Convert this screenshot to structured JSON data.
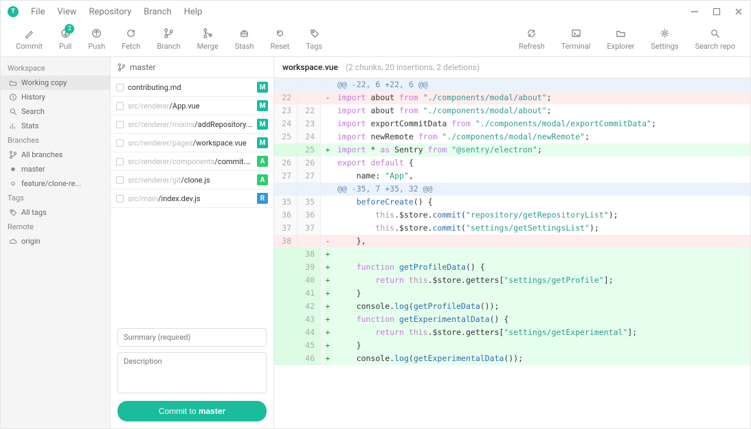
{
  "menubar": {
    "logo_text": "T",
    "items": [
      "File",
      "View",
      "Repository",
      "Branch",
      "Help"
    ]
  },
  "toolbar": {
    "left": [
      {
        "id": "commit",
        "label": "Commit",
        "icon": "pencil"
      },
      {
        "id": "pull",
        "label": "Pull",
        "icon": "arrow-down",
        "badge": "2"
      },
      {
        "id": "push",
        "label": "Push",
        "icon": "arrow-up"
      },
      {
        "id": "fetch",
        "label": "Fetch",
        "icon": "refresh"
      },
      {
        "id": "branch",
        "label": "Branch",
        "icon": "branch"
      },
      {
        "id": "merge",
        "label": "Merge",
        "icon": "merge"
      },
      {
        "id": "stash",
        "label": "Stash",
        "icon": "stash"
      },
      {
        "id": "reset",
        "label": "Reset",
        "icon": "reset"
      },
      {
        "id": "tags",
        "label": "Tags",
        "icon": "tag"
      }
    ],
    "right": [
      {
        "id": "refresh",
        "label": "Refresh",
        "icon": "refresh2"
      },
      {
        "id": "terminal",
        "label": "Terminal",
        "icon": "terminal"
      },
      {
        "id": "explorer",
        "label": "Explorer",
        "icon": "folder"
      },
      {
        "id": "settings",
        "label": "Settings",
        "icon": "gear"
      },
      {
        "id": "searchrepo",
        "label": "Search repo",
        "icon": "search"
      }
    ]
  },
  "sidebar": {
    "sections": [
      {
        "title": "Workspace",
        "items": [
          {
            "id": "working-copy",
            "label": "Working copy",
            "icon": "folder",
            "selected": true
          },
          {
            "id": "history",
            "label": "History",
            "icon": "clock"
          },
          {
            "id": "search",
            "label": "Search",
            "icon": "search"
          },
          {
            "id": "stats",
            "label": "Stats",
            "icon": "stats"
          }
        ]
      },
      {
        "title": "Branches",
        "items": [
          {
            "id": "all-branches",
            "label": "All branches",
            "icon": "branch"
          },
          {
            "id": "master",
            "label": "master",
            "icon": "dot"
          },
          {
            "id": "feature",
            "label": "feature/clone-re...",
            "icon": "circle"
          }
        ]
      },
      {
        "title": "Tags",
        "items": [
          {
            "id": "all-tags",
            "label": "All tags",
            "icon": "tag"
          }
        ]
      },
      {
        "title": "Remote",
        "items": [
          {
            "id": "origin",
            "label": "origin",
            "icon": "cloud"
          }
        ]
      }
    ]
  },
  "branchbar": {
    "icon": "branch",
    "name": "master"
  },
  "files": [
    {
      "prefix": "",
      "name": "contributing.md",
      "status": "M"
    },
    {
      "prefix": "src/renderer",
      "name": "/App.vue",
      "status": "M"
    },
    {
      "prefix": "src/renderer/mixins",
      "name": "/addRepository.js",
      "status": "M"
    },
    {
      "prefix": "src/renderer/pages",
      "name": "/workspace.vue",
      "status": "M"
    },
    {
      "prefix": "src/renderer/components",
      "name": "/commit.vue",
      "status": "A"
    },
    {
      "prefix": "src/renderer/git",
      "name": "/clone.js",
      "status": "A"
    },
    {
      "prefix": "src/main",
      "name": "/index.dev.js",
      "status": "R"
    }
  ],
  "commitform": {
    "summary_placeholder": "Summary (required)",
    "description_placeholder": "Description",
    "button_prefix": "Commit to ",
    "button_branch": "master"
  },
  "diff": {
    "filename": "workspace.vue",
    "stats": "(2 chunks, 20 insertions, 2 deletions)",
    "lines": [
      {
        "type": "hunk",
        "old": "",
        "new": "",
        "mark": "",
        "text": "@@ -22, 6 +22, 6 @@"
      },
      {
        "type": "del",
        "old": "22",
        "new": "",
        "mark": "-",
        "tokens": [
          [
            "kw",
            "import"
          ],
          [
            "id",
            " about "
          ],
          [
            "kw",
            "from"
          ],
          [
            "str",
            " \"./components/modal/about\""
          ],
          [
            "id",
            ";"
          ]
        ]
      },
      {
        "type": "ctx",
        "old": "23",
        "new": "22",
        "mark": "",
        "tokens": [
          [
            "kw",
            "import"
          ],
          [
            "id",
            " about "
          ],
          [
            "kw",
            "from"
          ],
          [
            "str",
            " \"./components/modal/about\""
          ],
          [
            "id",
            ";"
          ]
        ]
      },
      {
        "type": "ctx",
        "old": "24",
        "new": "23",
        "mark": "",
        "tokens": [
          [
            "kw",
            "import"
          ],
          [
            "id",
            " exportCommitData "
          ],
          [
            "kw",
            "from"
          ],
          [
            "str",
            " \"./components/modal/exportCommitData\""
          ],
          [
            "id",
            ";"
          ]
        ]
      },
      {
        "type": "ctx",
        "old": "25",
        "new": "24",
        "mark": "",
        "tokens": [
          [
            "kw",
            "import"
          ],
          [
            "id",
            " newRemote "
          ],
          [
            "kw",
            "from"
          ],
          [
            "str",
            " \"./components/modal/newRemote\""
          ],
          [
            "id",
            ";"
          ]
        ]
      },
      {
        "type": "add",
        "old": "",
        "new": "25",
        "mark": "+",
        "tokens": [
          [
            "kw",
            "import"
          ],
          [
            "id",
            " * "
          ],
          [
            "kw",
            "as"
          ],
          [
            "id",
            " Sentry "
          ],
          [
            "kw",
            "from"
          ],
          [
            "str",
            " \"@sentry/electron\""
          ],
          [
            "id",
            ";"
          ]
        ]
      },
      {
        "type": "ctx",
        "old": "26",
        "new": "26",
        "mark": "",
        "tokens": [
          [
            "kw",
            "export"
          ],
          [
            "id",
            " "
          ],
          [
            "kw",
            "default"
          ],
          [
            "id",
            " {"
          ]
        ]
      },
      {
        "type": "ctx",
        "old": "27",
        "new": "27",
        "mark": "",
        "tokens": [
          [
            "id",
            "    name: "
          ],
          [
            "str",
            "\"App\""
          ],
          [
            "id",
            ","
          ]
        ]
      },
      {
        "type": "hunk",
        "old": "",
        "new": "",
        "mark": "",
        "text": "@@ -35, 7 +35, 32 @@"
      },
      {
        "type": "ctx",
        "old": "35",
        "new": "35",
        "mark": "",
        "tokens": [
          [
            "id",
            "    "
          ],
          [
            "fn",
            "beforeCreate"
          ],
          [
            "id",
            "() {"
          ]
        ]
      },
      {
        "type": "ctx",
        "old": "36",
        "new": "36",
        "mark": "",
        "tokens": [
          [
            "id",
            "        "
          ],
          [
            "this",
            "this"
          ],
          [
            "id",
            ".$store."
          ],
          [
            "fn",
            "commit"
          ],
          [
            "id",
            "("
          ],
          [
            "str",
            "\"repository/getRepositoryList\""
          ],
          [
            "id",
            ");"
          ]
        ]
      },
      {
        "type": "ctx",
        "old": "37",
        "new": "37",
        "mark": "",
        "tokens": [
          [
            "id",
            "        "
          ],
          [
            "this",
            "this"
          ],
          [
            "id",
            ".$store."
          ],
          [
            "fn",
            "commit"
          ],
          [
            "id",
            "("
          ],
          [
            "str",
            "\"settings/getSettingsList\""
          ],
          [
            "id",
            ");"
          ]
        ]
      },
      {
        "type": "del",
        "old": "38",
        "new": "",
        "mark": "-",
        "tokens": [
          [
            "id",
            "    },"
          ]
        ]
      },
      {
        "type": "add",
        "old": "",
        "new": "38",
        "mark": "+",
        "tokens": [
          [
            "id",
            ""
          ]
        ]
      },
      {
        "type": "add",
        "old": "",
        "new": "39",
        "mark": "+",
        "tokens": [
          [
            "id",
            "    "
          ],
          [
            "kw",
            "function"
          ],
          [
            "id",
            " "
          ],
          [
            "fn",
            "getProfileData"
          ],
          [
            "id",
            "() {"
          ]
        ]
      },
      {
        "type": "add",
        "old": "",
        "new": "40",
        "mark": "+",
        "tokens": [
          [
            "id",
            "        "
          ],
          [
            "kw",
            "return"
          ],
          [
            "id",
            " "
          ],
          [
            "this",
            "this"
          ],
          [
            "id",
            ".$store.getters["
          ],
          [
            "str",
            "\"settings/getProfile\""
          ],
          [
            "id",
            "];"
          ]
        ]
      },
      {
        "type": "add",
        "old": "",
        "new": "41",
        "mark": "+",
        "tokens": [
          [
            "id",
            "    }"
          ]
        ]
      },
      {
        "type": "add",
        "old": "",
        "new": "42",
        "mark": "+",
        "tokens": [
          [
            "id",
            "    console."
          ],
          [
            "fn",
            "log"
          ],
          [
            "id",
            "("
          ],
          [
            "fn",
            "getProfileData"
          ],
          [
            "id",
            "());"
          ]
        ]
      },
      {
        "type": "add",
        "old": "",
        "new": "43",
        "mark": "+",
        "tokens": [
          [
            "id",
            "    "
          ],
          [
            "kw",
            "function"
          ],
          [
            "id",
            " "
          ],
          [
            "fn",
            "getExperimentalData"
          ],
          [
            "id",
            "() {"
          ]
        ]
      },
      {
        "type": "add",
        "old": "",
        "new": "44",
        "mark": "+",
        "tokens": [
          [
            "id",
            "        "
          ],
          [
            "kw",
            "return"
          ],
          [
            "id",
            " "
          ],
          [
            "this",
            "this"
          ],
          [
            "id",
            ".$store.getters["
          ],
          [
            "str",
            "\"settings/getExperimental\""
          ],
          [
            "id",
            "];"
          ]
        ]
      },
      {
        "type": "add",
        "old": "",
        "new": "45",
        "mark": "+",
        "tokens": [
          [
            "id",
            "    }"
          ]
        ]
      },
      {
        "type": "add",
        "old": "",
        "new": "46",
        "mark": "+",
        "tokens": [
          [
            "id",
            "    console."
          ],
          [
            "fn",
            "log"
          ],
          [
            "id",
            "("
          ],
          [
            "fn",
            "getExperimentalData"
          ],
          [
            "id",
            "());"
          ]
        ]
      }
    ]
  }
}
